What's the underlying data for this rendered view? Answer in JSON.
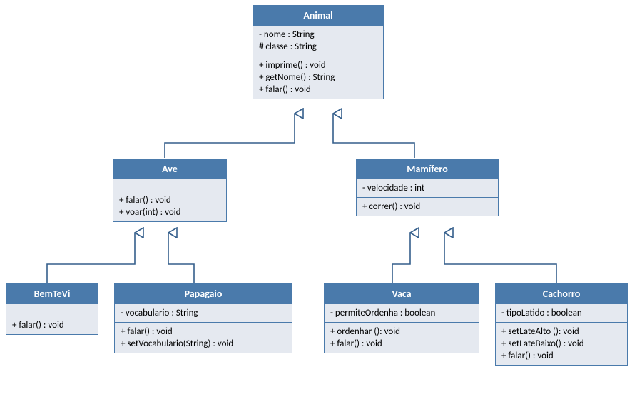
{
  "classes": {
    "animal": {
      "name": "Animal",
      "attrs": [
        "- nome : String",
        "# classe : String"
      ],
      "ops": [
        "+ imprime() : void",
        "+ getNome() : String",
        "+ falar() : void"
      ]
    },
    "ave": {
      "name": "Ave",
      "attrs": [],
      "ops": [
        "+ falar() : void",
        "+ voar(int) : void"
      ]
    },
    "mamifero": {
      "name": "Mamífero",
      "attrs": [
        "- velocidade : int"
      ],
      "ops": [
        "+ correr()  : void"
      ]
    },
    "bemtevi": {
      "name": "BemTeVi",
      "attrs": [],
      "ops": [
        "+ falar() : void"
      ]
    },
    "papagaio": {
      "name": "Papagaio",
      "attrs": [
        "- vocabulario : String"
      ],
      "ops": [
        "+ falar() : void",
        "+ setVocabulario(String) : void"
      ]
    },
    "vaca": {
      "name": "Vaca",
      "attrs": [
        "- permiteOrdenha : boolean"
      ],
      "ops": [
        "+ ordenhar (): void",
        "+ falar() : void"
      ]
    },
    "cachorro": {
      "name": "Cachorro",
      "attrs": [
        "- tipoLatido : boolean"
      ],
      "ops": [
        "+ setLateAlto (): void",
        "+ setLateBaixo() : void",
        "+ falar() : void"
      ]
    }
  },
  "chart_data": {
    "type": "uml-class-diagram",
    "classes": [
      {
        "id": "animal",
        "name": "Animal",
        "attributes": [
          "- nome : String",
          "# classe : String"
        ],
        "operations": [
          "+ imprime() : void",
          "+ getNome() : String",
          "+ falar() : void"
        ]
      },
      {
        "id": "ave",
        "name": "Ave",
        "attributes": [],
        "operations": [
          "+ falar() : void",
          "+ voar(int) : void"
        ]
      },
      {
        "id": "mamifero",
        "name": "Mamífero",
        "attributes": [
          "- velocidade : int"
        ],
        "operations": [
          "+ correr()  : void"
        ]
      },
      {
        "id": "bemtevi",
        "name": "BemTeVi",
        "attributes": [],
        "operations": [
          "+ falar() : void"
        ]
      },
      {
        "id": "papagaio",
        "name": "Papagaio",
        "attributes": [
          "- vocabulario : String"
        ],
        "operations": [
          "+ falar() : void",
          "+ setVocabulario(String) : void"
        ]
      },
      {
        "id": "vaca",
        "name": "Vaca",
        "attributes": [
          "- permiteOrdenha : boolean"
        ],
        "operations": [
          "+ ordenhar (): void",
          "+ falar() : void"
        ]
      },
      {
        "id": "cachorro",
        "name": "Cachorro",
        "attributes": [
          "- tipoLatido : boolean"
        ],
        "operations": [
          "+ setLateAlto (): void",
          "+ setLateBaixo() : void",
          "+ falar() : void"
        ]
      }
    ],
    "generalizations": [
      {
        "child": "ave",
        "parent": "animal"
      },
      {
        "child": "mamifero",
        "parent": "animal"
      },
      {
        "child": "bemtevi",
        "parent": "ave"
      },
      {
        "child": "papagaio",
        "parent": "ave"
      },
      {
        "child": "vaca",
        "parent": "mamifero"
      },
      {
        "child": "cachorro",
        "parent": "mamifero"
      }
    ]
  }
}
